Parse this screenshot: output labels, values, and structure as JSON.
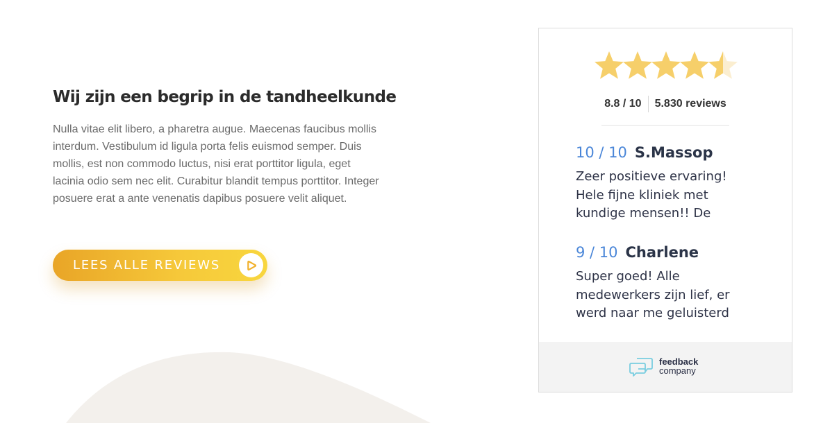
{
  "intro": {
    "title": "Wij zijn een begrip in de tandheelkunde",
    "body": "Nulla vitae elit libero, a pharetra augue. Maecenas faucibus mollis interdum. Vestibulum id ligula porta felis euismod semper. Duis mollis, est non commodo luctus, nisi erat porttitor ligula, eget lacinia odio sem nec elit. Curabitur blandit tempus porttitor. Integer posuere erat a ante venenatis dapibus posuere velit aliquet."
  },
  "cta": {
    "label": "LEES ALLE REVIEWS",
    "icon": "play-circle-icon"
  },
  "widget": {
    "stars_rating": 4.5,
    "stars_max": 5,
    "score": "8.8 / 10",
    "review_count": "5.830 reviews",
    "reviews": [
      {
        "score": "10 / 10",
        "name": "S.Massop",
        "text": "Zeer positieve ervaring! Hele fijne kliniek met kundige mensen!! De"
      },
      {
        "score": "9 / 10",
        "name": "Charlene",
        "text": "Super goed! Alle medewerkers zijn lief, er werd naar me geluisterd"
      }
    ],
    "footer": {
      "brand_line1": "feedback",
      "brand_line2": "company",
      "logo_icon": "chat-bubbles-icon"
    }
  },
  "colors": {
    "star": "#f6cf6a",
    "accent_blue": "#4a86d8",
    "cta_gradient_start": "#e9a527",
    "cta_gradient_end": "#f8d63e",
    "decor_shape": "#f3f0ec"
  }
}
